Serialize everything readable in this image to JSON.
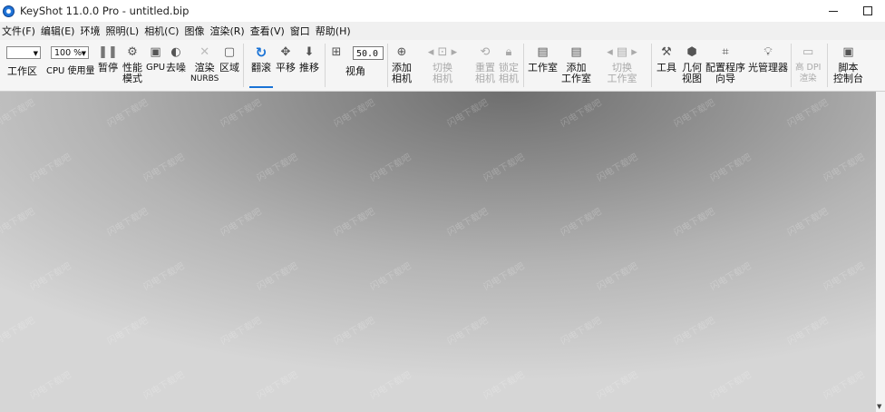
{
  "window": {
    "title": "KeyShot 11.0.0 Pro  - untitled.bip",
    "minimize": "minimize",
    "maximize": "maximize"
  },
  "menu": [
    "文件(F)",
    "编辑(E)",
    "环境",
    "照明(L)",
    "相机(C)",
    "图像",
    "渲染(R)",
    "查看(V)",
    "窗口",
    "帮助(H)"
  ],
  "toolbar": {
    "workspace_dropdown": "",
    "workspace_label": "工作区",
    "cpu_percent": "100 %",
    "cpu_label": "CPU 使用量",
    "pause": "暂停",
    "perf_mode": [
      "性能",
      "模式"
    ],
    "gpu": "GPU",
    "denoise": "去噪",
    "render_nurbs": [
      "渲染",
      "NURBS"
    ],
    "region": "区域",
    "tumble": "翻滚",
    "pan": "平移",
    "dolly": "推移",
    "fov_value": "50.0",
    "fov_label": "视角",
    "add_camera": [
      "添加",
      "相机"
    ],
    "switch_camera": [
      "切换",
      "相机"
    ],
    "reset_camera": [
      "重置",
      "相机"
    ],
    "lock_camera": [
      "锁定",
      "相机"
    ],
    "studio": "工作室",
    "add_studio": [
      "添加",
      "工作室"
    ],
    "switch_studio": [
      "切换",
      "工作室"
    ],
    "tools": "工具",
    "geometry_view": [
      "几何",
      "视图"
    ],
    "config_wizard": [
      "配置程序",
      "向导"
    ],
    "light_manager": "光管理器",
    "hdpi_render": [
      "高 DPI",
      "渲染"
    ],
    "script_console": [
      "脚本",
      "控制台"
    ]
  },
  "watermark": "闪电下载吧",
  "colors": {
    "accent": "#1a73d6",
    "toolbar_bg": "#f5f5f5",
    "menu_bg": "#f0f0f0"
  },
  "icons": {
    "pause": "pause-icon",
    "perf": "performance-icon",
    "gpu": "gpu-chip-icon",
    "denoise": "denoise-icon",
    "nurbs": "nurbs-icon",
    "region": "region-icon",
    "tumble": "tumble-icon",
    "pan": "pan-icon",
    "dolly": "dolly-icon",
    "fov": "fov-icon"
  }
}
